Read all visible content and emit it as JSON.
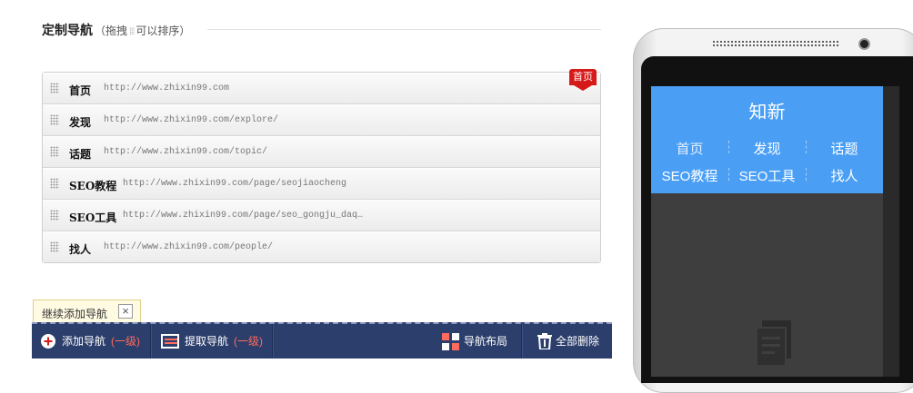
{
  "header": {
    "title": "定制导航",
    "hint_prefix": "（拖拽",
    "hint_suffix": "可以排序）"
  },
  "nav_items": [
    {
      "name": "首页",
      "url": "http://www.zhixin99.com"
    },
    {
      "name": "发现",
      "url": "http://www.zhixin99.com/explore/"
    },
    {
      "name": "话题",
      "url": "http://www.zhixin99.com/topic/"
    },
    {
      "name": "SEO教程",
      "url": "http://www.zhixin99.com/page/seojiaocheng"
    },
    {
      "name": "SEO工具",
      "url": "http://www.zhixin99.com/page/seo_gongju_daq…"
    },
    {
      "name": "找人",
      "url": "http://www.zhixin99.com/people/"
    }
  ],
  "home_badge": "首页",
  "tooltip": {
    "text": "继续添加导航",
    "close": "×"
  },
  "toolbar": {
    "add_label": "添加导航",
    "add_level": "(一级)",
    "fetch_label": "提取导航",
    "fetch_level": "(一级)",
    "layout_label": "导航布局",
    "delete_label": "全部删除"
  },
  "mobile": {
    "title": "知新",
    "nav": [
      "首页",
      "发现",
      "话题",
      "SEO教程",
      "SEO工具",
      "找人"
    ]
  },
  "colors": {
    "toolbar_bg": "#2c3e6b",
    "mobile_header_bg": "#4a9ff5",
    "badge_red": "#d61a1a",
    "level_red": "#ff6b5e"
  },
  "icons": {
    "add": "plus-circle-icon",
    "fetch": "list-extract-icon",
    "layout": "grid-layout-icon",
    "delete": "trash-icon",
    "drag": "drag-handle-icon",
    "doc": "document-icon"
  }
}
